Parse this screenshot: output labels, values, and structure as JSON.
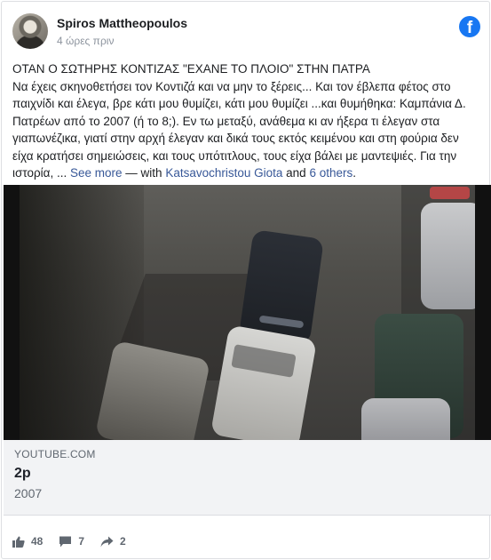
{
  "post": {
    "author": "Spiros Mattheopoulos",
    "time": "4 ώρες πριν",
    "text_line1": "ΟΤΑΝ Ο ΣΩΤΗΡΗΣ ΚΟΝΤΙΖΑΣ \"ΕΧΑΝΕ ΤΟ ΠΛΟΙΟ\" ΣΤΗΝ ΠΑΤΡΑ",
    "text_body": "Να έχεις σκηνοθετήσει τον Κοντιζά και να μην το ξέρεις... Και τον έβλεπα φέτος στο παιχνίδι και έλεγα, βρε κάτι μου θυμίζει, κάτι μου θυμίζει ...και θυμήθηκα: Καμπάνια Δ. Πατρέων από το 2007 (ή το 8;). Εν τω μεταξύ, ανάθεμα κι αν ήξερα τι έλεγαν στα γιαπωνέζικα, γιατί στην αρχή έλεγαν και δικά τους εκτός κειμένου και στη φούρια δεν είχα κρατήσει σημειώσεις, και τους υπότιτλους, τους είχα βάλει με μαντεψιές. Για την ιστορία, ...",
    "see_more": "See more",
    "with_prefix": "— with",
    "tagged_person": "Katsavochristou Giota",
    "and_text": "and",
    "others": "6 others",
    "period": "."
  },
  "link_preview": {
    "domain": "YOUTUBE.COM",
    "title": "2p",
    "description": "2007"
  },
  "stats": {
    "likes": "48",
    "comments": "7",
    "shares": "2"
  },
  "colors": {
    "link": "#385898",
    "facebook_blue": "#1877f2",
    "meta_bg": "#f2f3f5"
  },
  "icons": [
    "avatar",
    "facebook-logo-icon",
    "like-icon",
    "comment-icon",
    "share-icon"
  ]
}
